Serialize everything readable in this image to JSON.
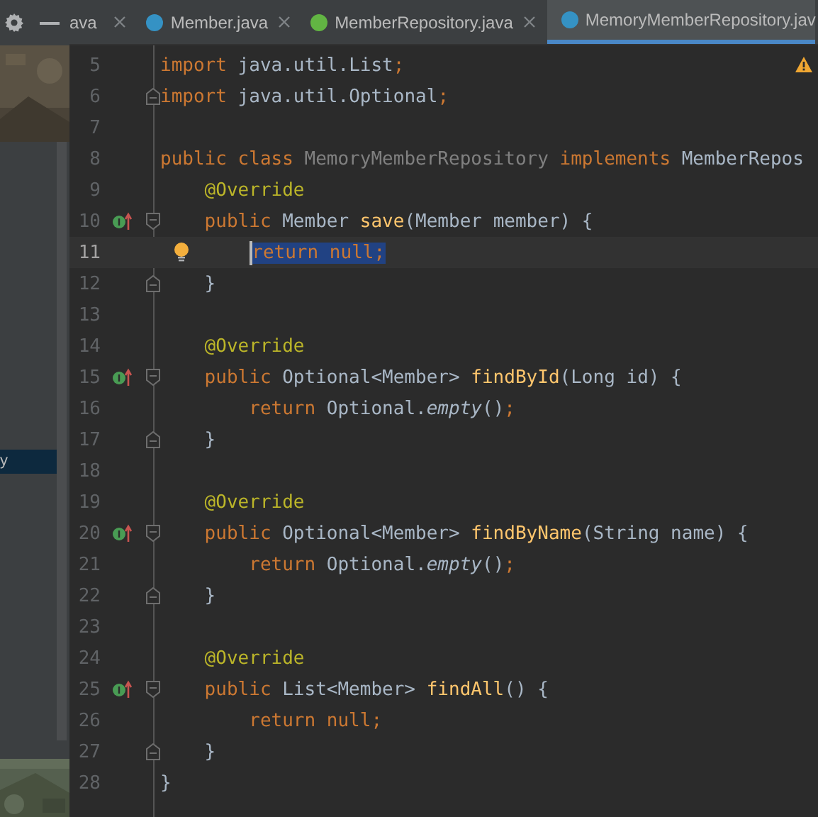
{
  "toolbar": {
    "buttons": [
      {
        "kind": "settings"
      },
      {
        "kind": "hide"
      }
    ]
  },
  "tabs": [
    {
      "label": "ava",
      "kind": "plain",
      "selected": false
    },
    {
      "label": "Member.java",
      "kind": "class",
      "selected": false
    },
    {
      "label": "MemberRepository.java",
      "kind": "interface",
      "selected": false
    },
    {
      "label": "MemoryMemberRepository.jav",
      "kind": "class",
      "selected": true
    }
  ],
  "sidebar": {
    "items": [
      {
        "label": "y",
        "selected": true
      }
    ]
  },
  "editor": {
    "warning": true,
    "lines": [
      {
        "number": "5",
        "current": false,
        "implements": false,
        "bulb": false,
        "fold_start": false,
        "fold_end": false,
        "tokens": [
          {
            "text": "import ",
            "kind": "keyword"
          },
          {
            "text": "java.util.List",
            "kind": "plain"
          },
          {
            "text": ";",
            "kind": "keyword"
          }
        ]
      },
      {
        "number": "6",
        "current": false,
        "implements": false,
        "bulb": false,
        "fold_start": false,
        "fold_end": true,
        "tokens": [
          {
            "text": "import ",
            "kind": "keyword"
          },
          {
            "text": "java.util.Optional",
            "kind": "plain"
          },
          {
            "text": ";",
            "kind": "keyword"
          }
        ]
      },
      {
        "number": "7",
        "current": false,
        "implements": false,
        "bulb": false,
        "fold_start": false,
        "fold_end": false
      },
      {
        "number": "8",
        "current": false,
        "implements": false,
        "bulb": false,
        "fold_start": false,
        "fold_end": false,
        "tokens": [
          {
            "text": "public class ",
            "kind": "keyword"
          },
          {
            "text": "MemoryMemberRepository ",
            "kind": "unused"
          },
          {
            "text": "implements ",
            "kind": "keyword"
          },
          {
            "text": "MemberRepos",
            "kind": "plain"
          }
        ]
      },
      {
        "number": "9",
        "current": false,
        "implements": false,
        "bulb": false,
        "fold_start": false,
        "fold_end": false,
        "tokens": [
          {
            "text": "    @Override",
            "kind": "annotation"
          }
        ]
      },
      {
        "number": "10",
        "current": false,
        "implements": true,
        "bulb": false,
        "fold_start": true,
        "fold_end": false,
        "tokens": [
          {
            "text": "    public ",
            "kind": "keyword"
          },
          {
            "text": "Member ",
            "kind": "plain"
          },
          {
            "text": "save",
            "kind": "method"
          },
          {
            "text": "(Member member) {",
            "kind": "plain"
          }
        ]
      },
      {
        "number": "11",
        "current": true,
        "implements": false,
        "bulb": true,
        "fold_start": false,
        "fold_end": false,
        "tokens": [
          {
            "text": "        return null;",
            "kind": "keyword",
            "selected": true
          }
        ]
      },
      {
        "number": "12",
        "current": false,
        "implements": false,
        "bulb": false,
        "fold_start": false,
        "fold_end": true,
        "tokens": [
          {
            "text": "    }",
            "kind": "plain"
          }
        ]
      },
      {
        "number": "13",
        "current": false,
        "implements": false,
        "bulb": false,
        "fold_start": false,
        "fold_end": false
      },
      {
        "number": "14",
        "current": false,
        "implements": false,
        "bulb": false,
        "fold_start": false,
        "fold_end": false,
        "tokens": [
          {
            "text": "    @Override",
            "kind": "annotation"
          }
        ]
      },
      {
        "number": "15",
        "current": false,
        "implements": true,
        "bulb": false,
        "fold_start": true,
        "fold_end": false,
        "tokens": [
          {
            "text": "    public ",
            "kind": "keyword"
          },
          {
            "text": "Optional<Member> ",
            "kind": "plain"
          },
          {
            "text": "findById",
            "kind": "method"
          },
          {
            "text": "(Long id) {",
            "kind": "plain"
          }
        ]
      },
      {
        "number": "16",
        "current": false,
        "implements": false,
        "bulb": false,
        "fold_start": false,
        "fold_end": false,
        "tokens": [
          {
            "text": "        return ",
            "kind": "keyword"
          },
          {
            "text": "Optional.",
            "kind": "plain"
          },
          {
            "text": "empty",
            "kind": "static"
          },
          {
            "text": "()",
            "kind": "plain"
          },
          {
            "text": ";",
            "kind": "keyword"
          }
        ]
      },
      {
        "number": "17",
        "current": false,
        "implements": false,
        "bulb": false,
        "fold_start": false,
        "fold_end": true,
        "tokens": [
          {
            "text": "    }",
            "kind": "plain"
          }
        ]
      },
      {
        "number": "18",
        "current": false,
        "implements": false,
        "bulb": false,
        "fold_start": false,
        "fold_end": false
      },
      {
        "number": "19",
        "current": false,
        "implements": false,
        "bulb": false,
        "fold_start": false,
        "fold_end": false,
        "tokens": [
          {
            "text": "    @Override",
            "kind": "annotation"
          }
        ]
      },
      {
        "number": "20",
        "current": false,
        "implements": true,
        "bulb": false,
        "fold_start": true,
        "fold_end": false,
        "tokens": [
          {
            "text": "    public ",
            "kind": "keyword"
          },
          {
            "text": "Optional<Member> ",
            "kind": "plain"
          },
          {
            "text": "findByName",
            "kind": "method"
          },
          {
            "text": "(String name) {",
            "kind": "plain"
          }
        ]
      },
      {
        "number": "21",
        "current": false,
        "implements": false,
        "bulb": false,
        "fold_start": false,
        "fold_end": false,
        "tokens": [
          {
            "text": "        return ",
            "kind": "keyword"
          },
          {
            "text": "Optional.",
            "kind": "plain"
          },
          {
            "text": "empty",
            "kind": "static"
          },
          {
            "text": "()",
            "kind": "plain"
          },
          {
            "text": ";",
            "kind": "keyword"
          }
        ]
      },
      {
        "number": "22",
        "current": false,
        "implements": false,
        "bulb": false,
        "fold_start": false,
        "fold_end": true,
        "tokens": [
          {
            "text": "    }",
            "kind": "plain"
          }
        ]
      },
      {
        "number": "23",
        "current": false,
        "implements": false,
        "bulb": false,
        "fold_start": false,
        "fold_end": false
      },
      {
        "number": "24",
        "current": false,
        "implements": false,
        "bulb": false,
        "fold_start": false,
        "fold_end": false,
        "tokens": [
          {
            "text": "    @Override",
            "kind": "annotation"
          }
        ]
      },
      {
        "number": "25",
        "current": false,
        "implements": true,
        "bulb": false,
        "fold_start": true,
        "fold_end": false,
        "tokens": [
          {
            "text": "    public ",
            "kind": "keyword"
          },
          {
            "text": "List<Member> ",
            "kind": "plain"
          },
          {
            "text": "findAll",
            "kind": "method"
          },
          {
            "text": "() {",
            "kind": "plain"
          }
        ]
      },
      {
        "number": "26",
        "current": false,
        "implements": false,
        "bulb": false,
        "fold_start": false,
        "fold_end": false,
        "tokens": [
          {
            "text": "        return null;",
            "kind": "keyword"
          }
        ]
      },
      {
        "number": "27",
        "current": false,
        "implements": false,
        "bulb": false,
        "fold_start": false,
        "fold_end": true,
        "tokens": [
          {
            "text": "    }",
            "kind": "plain"
          }
        ]
      },
      {
        "number": "28",
        "current": false,
        "implements": false,
        "bulb": false,
        "fold_start": false,
        "fold_end": false,
        "tokens": [
          {
            "text": "}",
            "kind": "plain"
          }
        ]
      }
    ]
  }
}
